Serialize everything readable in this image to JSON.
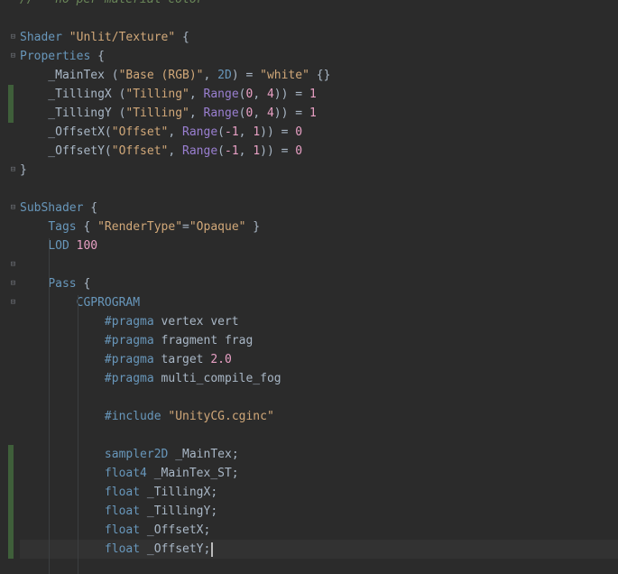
{
  "editor": {
    "lines": [
      "// - no per-material color",
      "",
      "Shader \"Unlit/Texture\" {",
      "Properties {",
      "    _MainTex (\"Base (RGB)\", 2D) = \"white\" {}",
      "    _TillingX (\"Tilling\", Range(0, 4)) = 1",
      "    _TillingY (\"Tilling\", Range(0, 4)) = 1",
      "    _OffsetX(\"Offset\", Range(-1, 1)) = 0",
      "    _OffsetY(\"Offset\", Range(-1, 1)) = 0",
      "}",
      "",
      "SubShader {",
      "    Tags { \"RenderType\"=\"Opaque\" }",
      "    LOD 100",
      "",
      "    Pass {",
      "        CGPROGRAM",
      "            #pragma vertex vert",
      "            #pragma fragment frag",
      "            #pragma target 2.0",
      "            #pragma multi_compile_fog",
      "",
      "            #include \"UnityCG.cginc\"",
      "",
      "            sampler2D _MainTex;",
      "            float4 _MainTex_ST;",
      "            float _TillingX;",
      "            float _TillingY;",
      "            float _OffsetX;",
      "            float _OffsetY;",
      ""
    ],
    "current_line": 29,
    "colors": {
      "background": "#2b2b2b",
      "keyword": "#6897bb",
      "string": "#d1a879",
      "number": "#e8a0c4",
      "comment": "#6a8759",
      "modified_marker": "#3f5f3a"
    }
  }
}
